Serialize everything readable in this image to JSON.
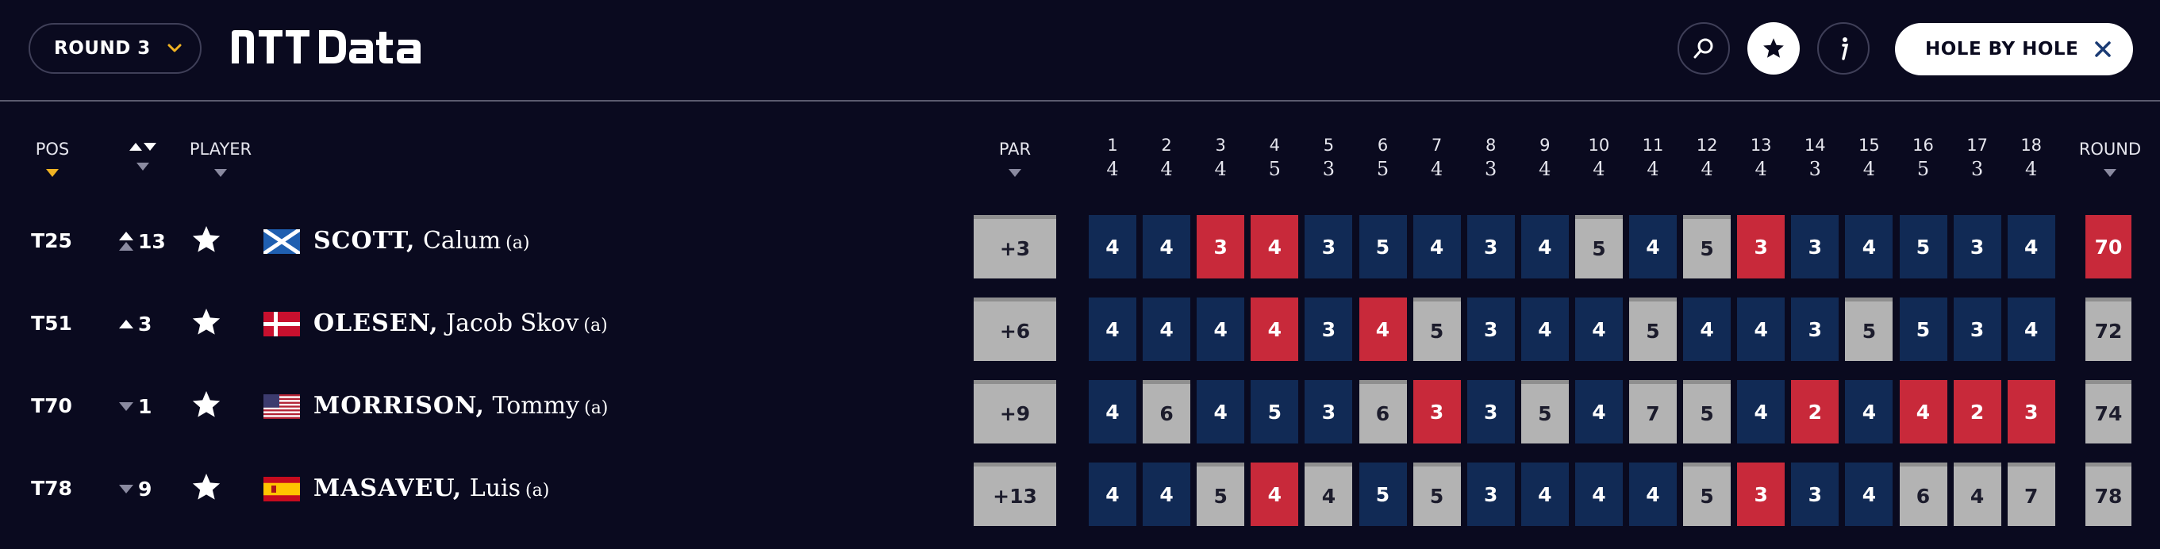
{
  "header": {
    "round_label": "ROUND 3",
    "logo_text": "NTT Data",
    "hole_by_hole_label": "HOLE BY HOLE"
  },
  "columns": {
    "pos": "POS",
    "player": "PLAYER",
    "par": "PAR",
    "round": "ROUND"
  },
  "holes": [
    {
      "n": "1",
      "par": "4"
    },
    {
      "n": "2",
      "par": "4"
    },
    {
      "n": "3",
      "par": "4"
    },
    {
      "n": "4",
      "par": "5"
    },
    {
      "n": "5",
      "par": "3"
    },
    {
      "n": "6",
      "par": "5"
    },
    {
      "n": "7",
      "par": "4"
    },
    {
      "n": "8",
      "par": "3"
    },
    {
      "n": "9",
      "par": "4"
    },
    {
      "n": "10",
      "par": "4"
    },
    {
      "n": "11",
      "par": "4"
    },
    {
      "n": "12",
      "par": "4"
    },
    {
      "n": "13",
      "par": "4"
    },
    {
      "n": "14",
      "par": "3"
    },
    {
      "n": "15",
      "par": "4"
    },
    {
      "n": "16",
      "par": "5"
    },
    {
      "n": "17",
      "par": "3"
    },
    {
      "n": "18",
      "par": "4"
    }
  ],
  "players": [
    {
      "pos": "T25",
      "move_dir": "up",
      "move": "13",
      "last": "SCOTT,",
      "first": "Calum",
      "amateur": "(a)",
      "flag": "scotland",
      "to_par": "+3",
      "round_total": "70",
      "round_color": "red",
      "scores": [
        {
          "v": "4",
          "c": "navy"
        },
        {
          "v": "4",
          "c": "navy"
        },
        {
          "v": "3",
          "c": "red"
        },
        {
          "v": "4",
          "c": "red"
        },
        {
          "v": "3",
          "c": "navy"
        },
        {
          "v": "5",
          "c": "navy"
        },
        {
          "v": "4",
          "c": "navy"
        },
        {
          "v": "3",
          "c": "navy"
        },
        {
          "v": "4",
          "c": "navy"
        },
        {
          "v": "5",
          "c": "grey"
        },
        {
          "v": "4",
          "c": "navy"
        },
        {
          "v": "5",
          "c": "grey"
        },
        {
          "v": "3",
          "c": "red"
        },
        {
          "v": "3",
          "c": "navy"
        },
        {
          "v": "4",
          "c": "navy"
        },
        {
          "v": "5",
          "c": "navy"
        },
        {
          "v": "3",
          "c": "navy"
        },
        {
          "v": "4",
          "c": "navy"
        }
      ]
    },
    {
      "pos": "T51",
      "move_dir": "up",
      "move": "3",
      "last": "OLESEN,",
      "first": "Jacob Skov",
      "amateur": "(a)",
      "flag": "denmark",
      "to_par": "+6",
      "round_total": "72",
      "round_color": "grey",
      "scores": [
        {
          "v": "4",
          "c": "navy"
        },
        {
          "v": "4",
          "c": "navy"
        },
        {
          "v": "4",
          "c": "navy"
        },
        {
          "v": "4",
          "c": "red"
        },
        {
          "v": "3",
          "c": "navy"
        },
        {
          "v": "4",
          "c": "red"
        },
        {
          "v": "5",
          "c": "grey"
        },
        {
          "v": "3",
          "c": "navy"
        },
        {
          "v": "4",
          "c": "navy"
        },
        {
          "v": "4",
          "c": "navy"
        },
        {
          "v": "5",
          "c": "grey"
        },
        {
          "v": "4",
          "c": "navy"
        },
        {
          "v": "4",
          "c": "navy"
        },
        {
          "v": "3",
          "c": "navy"
        },
        {
          "v": "5",
          "c": "grey"
        },
        {
          "v": "5",
          "c": "navy"
        },
        {
          "v": "3",
          "c": "navy"
        },
        {
          "v": "4",
          "c": "navy"
        }
      ]
    },
    {
      "pos": "T70",
      "move_dir": "down",
      "move": "1",
      "last": "MORRISON,",
      "first": "Tommy",
      "amateur": "(a)",
      "flag": "usa",
      "to_par": "+9",
      "round_total": "74",
      "round_color": "grey",
      "scores": [
        {
          "v": "4",
          "c": "navy"
        },
        {
          "v": "6",
          "c": "grey"
        },
        {
          "v": "4",
          "c": "navy"
        },
        {
          "v": "5",
          "c": "navy"
        },
        {
          "v": "3",
          "c": "navy"
        },
        {
          "v": "6",
          "c": "grey"
        },
        {
          "v": "3",
          "c": "red"
        },
        {
          "v": "3",
          "c": "navy"
        },
        {
          "v": "5",
          "c": "grey"
        },
        {
          "v": "4",
          "c": "navy"
        },
        {
          "v": "7",
          "c": "grey"
        },
        {
          "v": "5",
          "c": "grey"
        },
        {
          "v": "4",
          "c": "navy"
        },
        {
          "v": "2",
          "c": "red"
        },
        {
          "v": "4",
          "c": "navy"
        },
        {
          "v": "4",
          "c": "red"
        },
        {
          "v": "2",
          "c": "red"
        },
        {
          "v": "3",
          "c": "red"
        }
      ]
    },
    {
      "pos": "T78",
      "move_dir": "down",
      "move": "9",
      "last": "MASAVEU,",
      "first": "Luis",
      "amateur": "(a)",
      "flag": "spain",
      "to_par": "+13",
      "round_total": "78",
      "round_color": "grey",
      "scores": [
        {
          "v": "4",
          "c": "navy"
        },
        {
          "v": "4",
          "c": "navy"
        },
        {
          "v": "5",
          "c": "grey"
        },
        {
          "v": "4",
          "c": "red"
        },
        {
          "v": "4",
          "c": "grey"
        },
        {
          "v": "5",
          "c": "navy"
        },
        {
          "v": "5",
          "c": "grey"
        },
        {
          "v": "3",
          "c": "navy"
        },
        {
          "v": "4",
          "c": "navy"
        },
        {
          "v": "4",
          "c": "navy"
        },
        {
          "v": "4",
          "c": "navy"
        },
        {
          "v": "5",
          "c": "grey"
        },
        {
          "v": "3",
          "c": "red"
        },
        {
          "v": "3",
          "c": "navy"
        },
        {
          "v": "4",
          "c": "navy"
        },
        {
          "v": "6",
          "c": "grey"
        },
        {
          "v": "4",
          "c": "grey"
        },
        {
          "v": "7",
          "c": "grey"
        }
      ]
    }
  ],
  "colors": {
    "background": "#0a0a1f",
    "navy": "#112a55",
    "red": "#c8293a",
    "grey": "#b3b3b3",
    "accent": "#f0b323"
  },
  "icons": {
    "round_chevron": "chevron-down-icon",
    "search": "search-icon",
    "favorites": "star-icon",
    "info": "info-icon",
    "close": "close-icon",
    "sort_movement": "sort-arrows-icon",
    "favorite_player": "star-icon"
  }
}
